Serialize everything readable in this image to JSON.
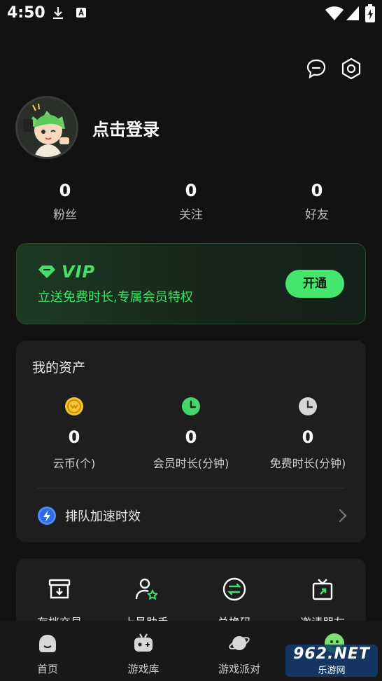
{
  "status_bar": {
    "time": "4:50"
  },
  "profile": {
    "login_text": "点击登录"
  },
  "stats": [
    {
      "value": "0",
      "label": "粉丝"
    },
    {
      "value": "0",
      "label": "关注"
    },
    {
      "value": "0",
      "label": "好友"
    }
  ],
  "vip": {
    "title": "VIP",
    "description": "立送免费时长,专属会员特权",
    "button": "开通"
  },
  "assets": {
    "title": "我的资产",
    "items": [
      {
        "value": "0",
        "label": "云币(个)"
      },
      {
        "value": "0",
        "label": "会员时长(分钟)"
      },
      {
        "value": "0",
        "label": "免费时长(分钟)"
      }
    ],
    "queue_label": "排队加速时效"
  },
  "tools": [
    {
      "label": "存档交易"
    },
    {
      "label": "上号助手"
    },
    {
      "label": "兑换码"
    },
    {
      "label": "邀请朋友"
    }
  ],
  "nav": [
    {
      "label": "首页"
    },
    {
      "label": "游戏库"
    },
    {
      "label": "游戏派对"
    }
  ],
  "watermark": {
    "top": "962.NET",
    "bottom": "乐游网"
  },
  "colors": {
    "accent": "#45e06a",
    "background": "#121212",
    "card": "#1e1e1e"
  }
}
